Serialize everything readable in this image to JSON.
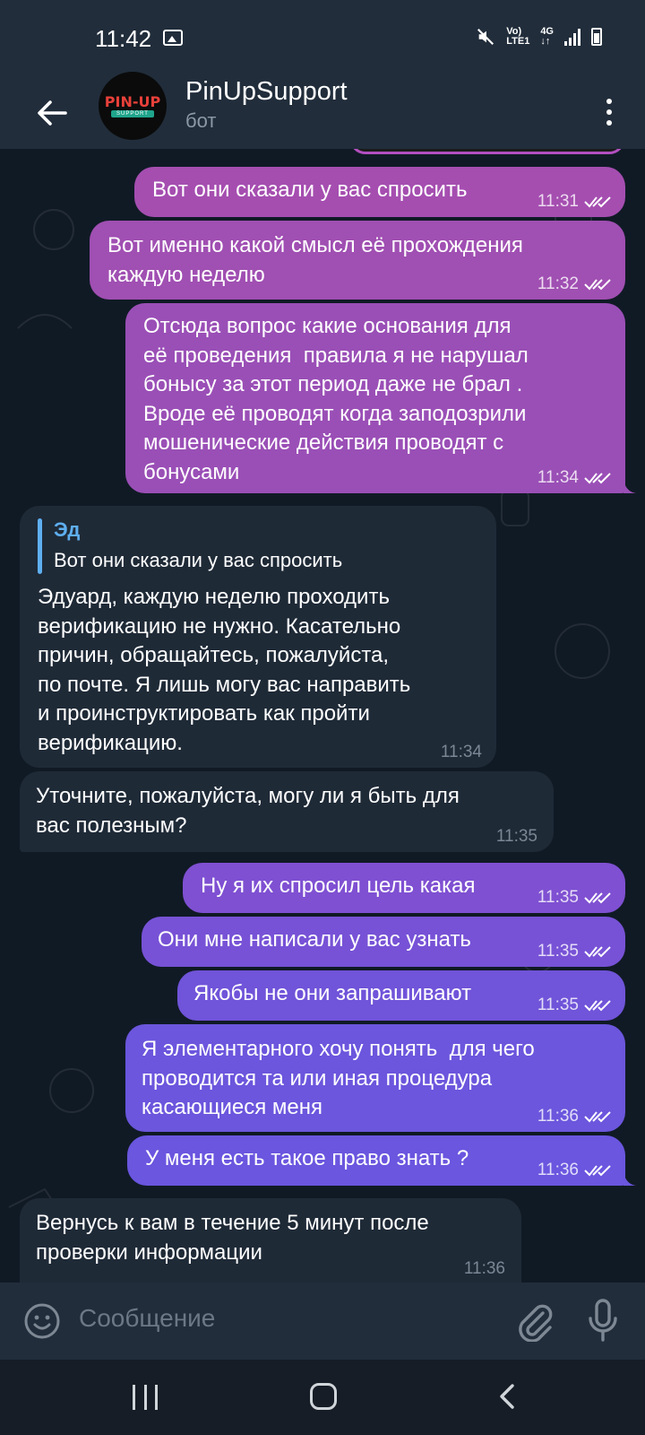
{
  "status_bar": {
    "time": "11:42",
    "network_line1": "Vo)",
    "network_line2": "LTE1",
    "network_4g": "4G"
  },
  "header": {
    "title": "PinUpSupport",
    "subtitle": "бот",
    "avatar_logo": "PIN-UP",
    "avatar_sub": "SUPPORT"
  },
  "messages": [
    {
      "dir": "out",
      "text": "Вот они сказали у вас спросить",
      "time": "11:31"
    },
    {
      "dir": "out",
      "text": "Вот именно какой смысл её прохождения\nкаждую неделю",
      "time": "11:32"
    },
    {
      "dir": "out",
      "text": "Отсюда вопрос какие основания для\nеё проведения  правила я не нарушал\nбонысу за этот период даже не брал .\nВроде её проводят когда заподозрили\nмошенические действия проводят с\nбонусами",
      "time": "11:34"
    },
    {
      "dir": "in",
      "reply_name": "Эд",
      "reply_text": "Вот они сказали у вас спросить",
      "text": "Эдуард, каждую неделю проходить\nверификацию не нужно. Касательно\nпричин, обращайтесь, пожалуйста,\nпо почте. Я лишь могу вас направить\nи проинструктировать как пройти\nверификацию.",
      "time": "11:34"
    },
    {
      "dir": "in",
      "text": "Уточните, пожалуйста, могу ли я быть для\nвас полезным?",
      "time": "11:35"
    },
    {
      "dir": "out",
      "text": "Ну я их спросил цель какая",
      "time": "11:35"
    },
    {
      "dir": "out",
      "text": "Они мне написали у вас узнать",
      "time": "11:35"
    },
    {
      "dir": "out",
      "text": "Якобы не они запрашивают",
      "time": "11:35"
    },
    {
      "dir": "out",
      "text": "Я элементарного хочу понять  для чего\nпроводится та или иная процедура\nкасающиеся меня",
      "time": "11:36"
    },
    {
      "dir": "out",
      "text": "У меня есть такое право знать ?",
      "time": "11:36"
    },
    {
      "dir": "in",
      "text": "Вернусь к вам в течение 5 минут после\nпроверки информации",
      "time": "11:36"
    }
  ],
  "input": {
    "placeholder": "Сообщение"
  },
  "colors": {
    "header_bg": "#212d3b",
    "incoming_bubble": "#1f2a37",
    "outgoing_top": "#9a48b5",
    "outgoing_bottom": "#6a4fe0"
  }
}
